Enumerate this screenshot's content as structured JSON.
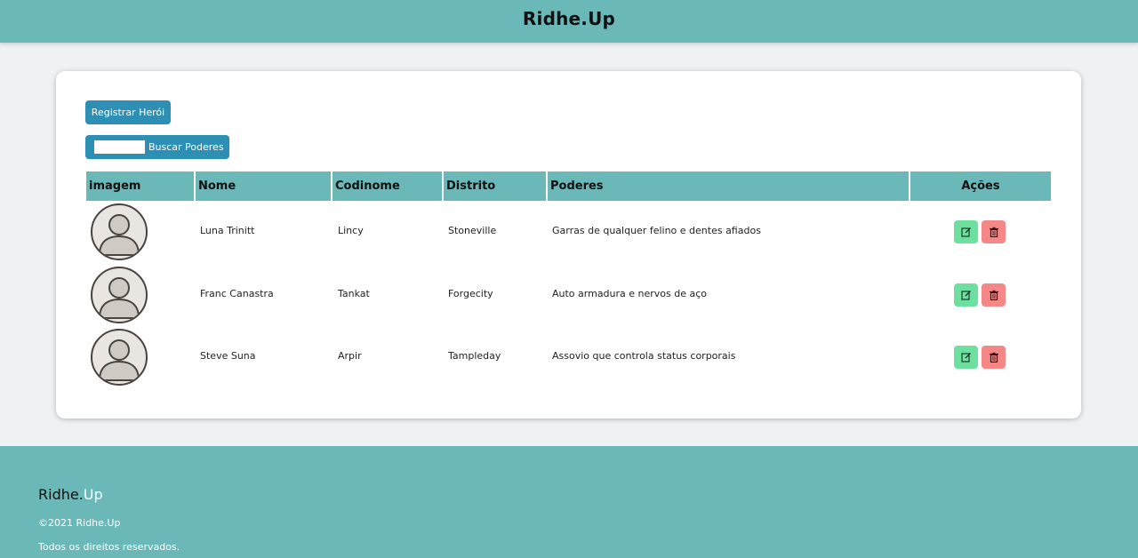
{
  "header": {
    "title": "Ridhe.Up"
  },
  "actions": {
    "register_label": "Registrar Herói",
    "search_label": "Buscar Poderes",
    "search_value": ""
  },
  "table": {
    "columns": [
      "imagem",
      "Nome",
      "Codinome",
      "Distrito",
      "Poderes",
      "Ações"
    ],
    "rows": [
      {
        "nome": "Luna Trinitt",
        "codinome": "Lincy",
        "distrito": "Stoneville",
        "poderes": "Garras de qualquer felino e dentes afiados"
      },
      {
        "nome": "Franc Canastra",
        "codinome": "Tankat",
        "distrito": "Forgecity",
        "poderes": "Auto armadura e nervos de aço"
      },
      {
        "nome": "Steve Suna",
        "codinome": "Arpir",
        "distrito": "Tampleday",
        "poderes": "Assovio que controla status corporais"
      }
    ],
    "row_icons": {
      "avatar": "user-avatar-icon",
      "edit": "edit-icon",
      "delete": "trash-icon"
    }
  },
  "footer": {
    "brand_part1": "Ridhe.",
    "brand_part2": "Up",
    "copyright": "©2021 Ridhe.Up",
    "rights": "Todos os direitos reservados."
  },
  "colors": {
    "teal": "#6ab8b8",
    "button_blue": "#2e8fb5",
    "edit_green": "#6de0a0",
    "delete_red": "#f58787"
  }
}
